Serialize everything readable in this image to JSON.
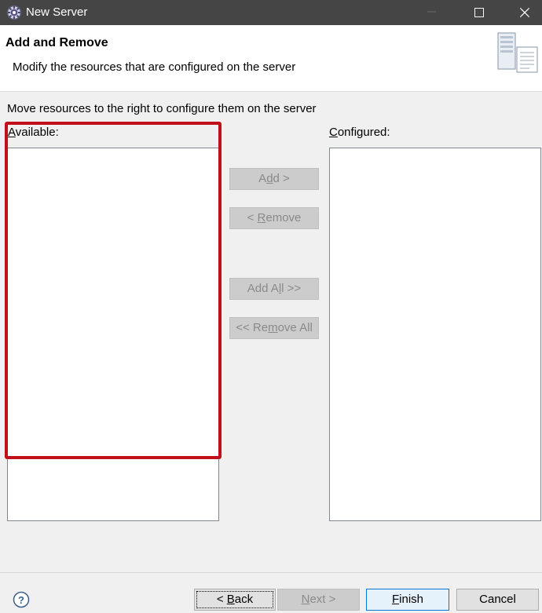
{
  "window": {
    "title": "New Server",
    "icons": [
      "app-gear-icon",
      "minimize-icon",
      "maximize-icon",
      "close-icon"
    ]
  },
  "banner": {
    "title": "Add and Remove",
    "description": "Modify the resources that are configured on the server",
    "icon": "server-icon"
  },
  "instruction": "Move resources to the right to configure them on the server",
  "available": {
    "label_mnemonic": "A",
    "label_rest": "vailable:",
    "items": []
  },
  "configured": {
    "label_mnemonic": "C",
    "label_rest": "onfigured:",
    "items": []
  },
  "middle_buttons": {
    "add": {
      "pre": "A",
      "mn": "d",
      "post": "d >"
    },
    "remove": {
      "pre": "< ",
      "mn": "R",
      "post": "emove"
    },
    "add_all": {
      "pre": "Add A",
      "mn": "l",
      "post": "l >>"
    },
    "remove_all": {
      "pre": "<< Re",
      "mn": "m",
      "post": "ove All"
    }
  },
  "footer": {
    "help_icon": "help-icon",
    "back": {
      "pre": "< ",
      "mn": "B",
      "post": "ack"
    },
    "next": {
      "pre": "",
      "mn": "N",
      "post": "ext >"
    },
    "finish": {
      "pre": "",
      "mn": "F",
      "post": "inish"
    },
    "cancel": "Cancel"
  },
  "colors": {
    "titlebar": "#454545",
    "highlight": "#c0111b",
    "finish_border": "#0078d7"
  }
}
